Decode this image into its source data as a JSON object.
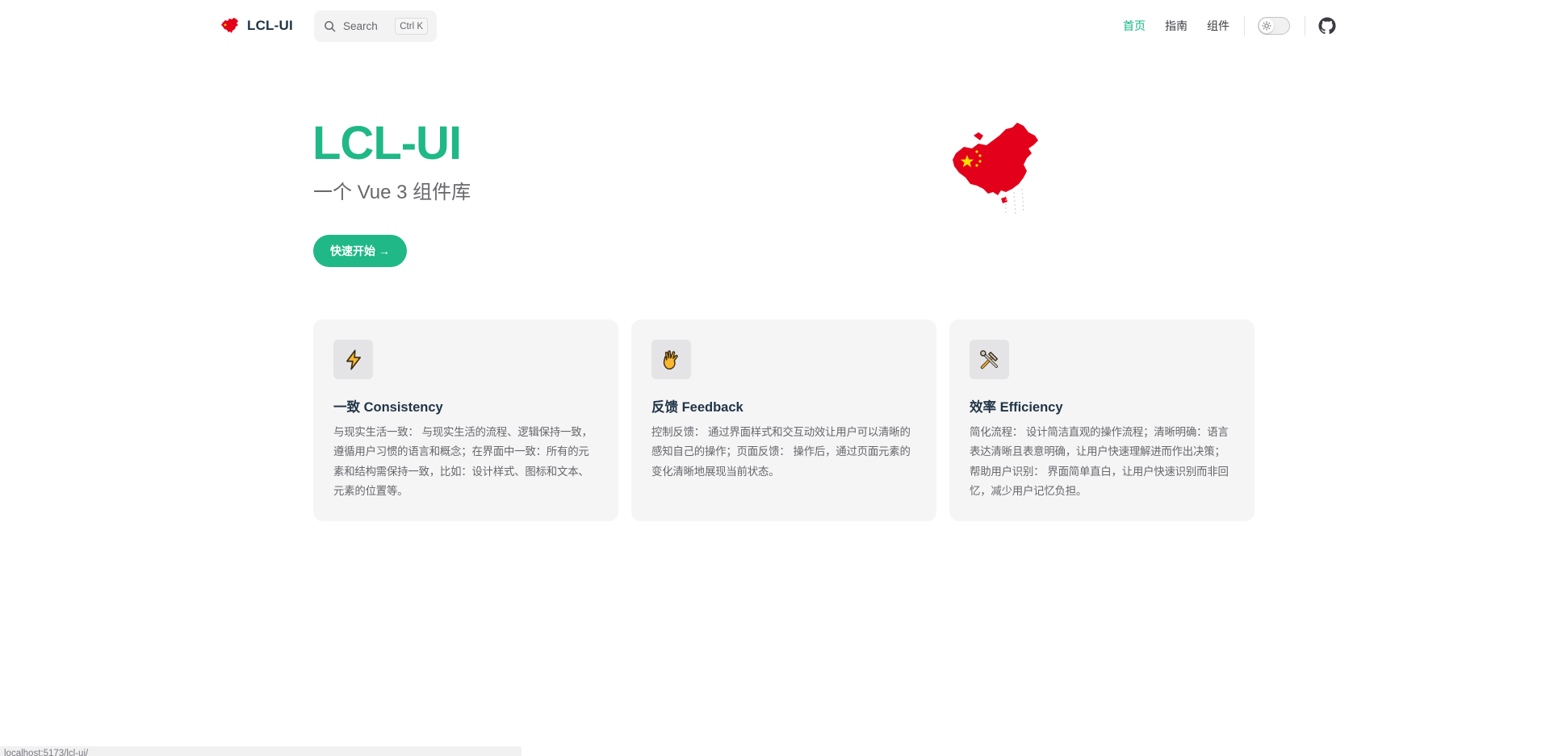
{
  "nav": {
    "brand_name": "LCL-UI",
    "search_placeholder": "Search",
    "search_shortcut": "Ctrl K",
    "links": [
      "首页",
      "指南",
      "组件"
    ],
    "active_link": "首页",
    "theme_toggle_icon": "sun-icon",
    "github_icon": "github-icon"
  },
  "hero": {
    "name": "LCL-UI",
    "tagline": "一个 Vue 3 组件库",
    "action_label": "快速开始 →",
    "image": "china-map-flag"
  },
  "features": [
    {
      "icon": "⚡",
      "icon_name": "lightning-icon",
      "title": "一致 Consistency",
      "details": "与现实生活一致： 与现实生活的流程、逻辑保持一致，遵循用户习惯的语言和概念；在界面中一致：所有的元素和结构需保持一致，比如：设计样式、图标和文本、元素的位置等。"
    },
    {
      "icon": "🖖",
      "icon_name": "vulcan-salute-icon",
      "title": "反馈 Feedback",
      "details": "控制反馈： 通过界面样式和交互动效让用户可以清晰的感知自己的操作；页面反馈： 操作后，通过页面元素的变化清晰地展现当前状态。"
    },
    {
      "icon": "🛠",
      "icon_name": "tools-icon",
      "title": "效率 Efficiency",
      "details": "简化流程： 设计简洁直观的操作流程；清晰明确：语言表达清晰且表意明确，让用户快速理解进而作出决策；帮助用户识别： 界面简单直白，让用户快速识别而非回忆，减少用户记忆负担。"
    }
  ],
  "status_bar": {
    "url": "localhost:5173/lcl-ui/"
  },
  "colors": {
    "brand": "#1fb886",
    "card_bg": "#f5f5f6",
    "text": "#3c3c43",
    "muted": "#67676c",
    "flag_red": "#e3001b",
    "flag_star": "#ffde00"
  }
}
